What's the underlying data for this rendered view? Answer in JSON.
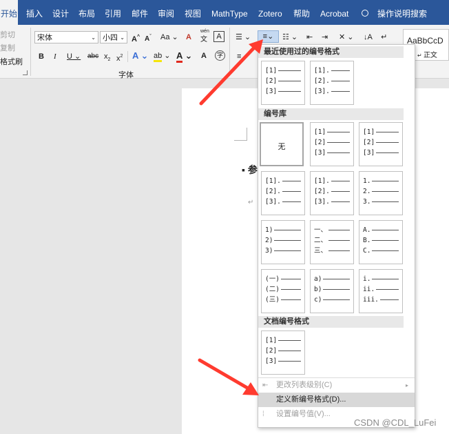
{
  "tabs": [
    {
      "label": "开始",
      "active": true
    },
    {
      "label": "插入"
    },
    {
      "label": "设计"
    },
    {
      "label": "布局"
    },
    {
      "label": "引用"
    },
    {
      "label": "邮件"
    },
    {
      "label": "审阅"
    },
    {
      "label": "视图"
    },
    {
      "label": "MathType"
    },
    {
      "label": "Zotero"
    },
    {
      "label": "帮助"
    },
    {
      "label": "Acrobat"
    },
    {
      "label": "操作说明搜索"
    }
  ],
  "clipboard": {
    "cut": "剪切",
    "copy": "复制",
    "format_painter": "格式刷"
  },
  "font": {
    "name": "宋体",
    "size": "小四",
    "group_label": "字体",
    "grow": "A",
    "shrink": "A",
    "case": "Aa",
    "clear": "A",
    "pinyin": "文",
    "border_char": "A"
  },
  "format_buttons": [
    "B",
    "I",
    "U",
    "abc",
    "x",
    "x"
  ],
  "styles": {
    "preview": "AaBbCcD",
    "name": "正文"
  },
  "dropdown": {
    "recent_header": "最近使用过的编号格式",
    "library_header": "编号库",
    "doc_header": "文档编号格式",
    "none_label": "无",
    "recent": [
      [
        "[1]",
        "[2]",
        "[3]"
      ],
      [
        "[1].",
        "[2].",
        "[3]."
      ]
    ],
    "library": [
      [
        "[1]",
        "[2]",
        "[3]"
      ],
      [
        "[1]",
        "[2]",
        "[3]"
      ],
      [
        "[1].",
        "[2].",
        "[3]."
      ],
      [
        "[1].",
        "[2].",
        "[3]."
      ],
      [
        "1.",
        "2.",
        "3."
      ],
      [
        "1)",
        "2)",
        "3)"
      ],
      [
        "一、",
        "二、",
        "三、"
      ],
      [
        "A.",
        "B.",
        "C."
      ],
      [
        "(一)",
        "(二)",
        "(三)"
      ],
      [
        "a)",
        "b)",
        "c)"
      ],
      [
        "i.",
        "ii.",
        "iii."
      ]
    ],
    "document": [
      [
        "[1]",
        "[2]",
        "[3]"
      ]
    ],
    "menu": {
      "change_level": "更改列表级别(C)",
      "define_new": "定义新编号格式(D)...",
      "set_value": "设置编号值(V)..."
    }
  },
  "doc": {
    "heading_fragment": "参"
  },
  "watermark": "CSDN @CDL_LuFei",
  "colors": {
    "tabbar": "#2b579a",
    "arrow": "#ff3b2f",
    "highlight": "#d8d8d8"
  }
}
